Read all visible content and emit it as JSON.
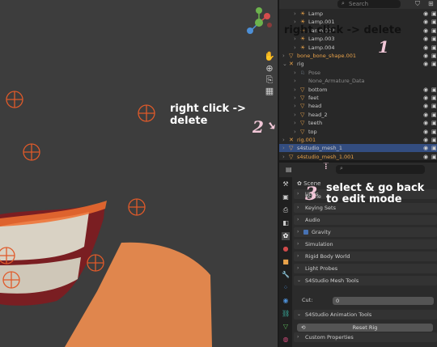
{
  "outliner": {
    "search_placeholder": "Search",
    "rows": [
      {
        "label": "Lamp",
        "kind": "lamp",
        "indent": 1
      },
      {
        "label": "Lamp.001",
        "kind": "lamp",
        "indent": 1
      },
      {
        "label": "Lamp.002",
        "kind": "lamp",
        "indent": 1
      },
      {
        "label": "Lamp.003",
        "kind": "lamp",
        "indent": 1
      },
      {
        "label": "Lamp.004",
        "kind": "lamp",
        "indent": 1
      },
      {
        "label": "bone_bone_shape.001",
        "kind": "mesh",
        "indent": 0,
        "style": "orange"
      },
      {
        "label": "rig",
        "kind": "armature",
        "indent": 0
      },
      {
        "label": "Pose",
        "kind": "pose",
        "indent": 1,
        "style": "dim"
      },
      {
        "label": "None_Armature_Data",
        "kind": "data",
        "indent": 1,
        "style": "dim"
      },
      {
        "label": "bottom",
        "kind": "mesh",
        "indent": 1
      },
      {
        "label": "feet",
        "kind": "mesh",
        "indent": 1
      },
      {
        "label": "head",
        "kind": "mesh",
        "indent": 1
      },
      {
        "label": "head_2",
        "kind": "mesh",
        "indent": 1
      },
      {
        "label": "teeth",
        "kind": "mesh",
        "indent": 1
      },
      {
        "label": "top",
        "kind": "mesh",
        "indent": 1
      },
      {
        "label": "rig.001",
        "kind": "armature",
        "indent": 0,
        "style": "orange"
      },
      {
        "label": "s4studio_mesh_1",
        "kind": "mesh",
        "indent": 0,
        "style": "sel"
      },
      {
        "label": "s4studio_mesh_1.001",
        "kind": "mesh",
        "indent": 0,
        "style": "orange"
      }
    ]
  },
  "properties": {
    "search_placeholder": "",
    "context_label": "Scene",
    "panels": [
      {
        "label": "Scene"
      },
      {
        "label": "Units"
      },
      {
        "label": "Keying Sets"
      },
      {
        "label": "Audio"
      },
      {
        "label": "Gravity",
        "checkbox": true
      },
      {
        "label": "Simulation"
      },
      {
        "label": "Rigid Body World"
      },
      {
        "label": "Light Probes"
      },
      {
        "label": "S4Studio Mesh Tools",
        "open": true
      },
      {
        "label": "S4Studio Animation Tools",
        "open": true
      },
      {
        "label": "Custom Properties"
      }
    ],
    "cut_label": "Cut:",
    "cut_value": "0",
    "reset_rig_label": "Reset Rig"
  },
  "annotations": {
    "note1": "right click -> delete",
    "note1_num": "1",
    "note2": "right click -> delete",
    "note2_num": "2",
    "note3_line1": "select & go back",
    "note3_line2": "to edit mode",
    "note3_num": "3"
  },
  "colors": {
    "accent_orange": "#e8a24a",
    "selection_blue": "#334d80",
    "bone_orange": "#e05a2a"
  }
}
